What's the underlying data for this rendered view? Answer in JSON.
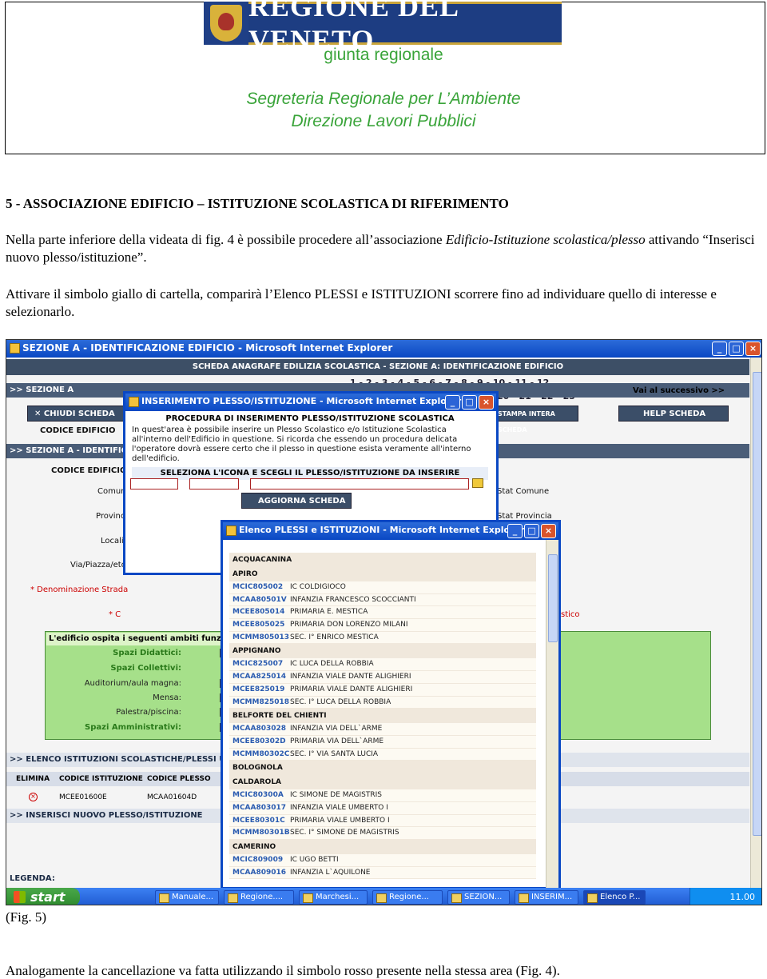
{
  "header": {
    "logo_text": "REGIONE DEL VENETO",
    "giunta": "giunta regionale",
    "segreteria": "Segreteria Regionale per L’Ambiente",
    "direzione": "Direzione Lavori Pubblici"
  },
  "doc": {
    "heading": "5 - ASSOCIAZIONE EDIFICIO – ISTITUZIONE SCOLASTICA DI RIFERIMENTO",
    "p1_a": "Nella parte inferiore della videata di fig. 4 è possibile procedere all’associazione ",
    "p1_em": "Edificio-Istituzione scolastica/plesso",
    "p1_b": " attivando “Inserisci nuovo plesso/istituzione”.",
    "p2": "Attivare il simbolo giallo di cartella, comparirà l’Elenco PLESSI e ISTITUZIONI scorrere fino ad individuare quello di interesse e selezionarlo.",
    "fig_caption": "(Fig. 5)",
    "last": "Analogamente la cancellazione va fatta utilizzando il simbolo rosso presente nella stessa area (Fig. 4)."
  },
  "screenshot": {
    "main_title": "SEZIONE A - IDENTIFICAZIONE EDIFICIO - Microsoft Internet Explorer",
    "scheda_header": "SCHEDA ANAGRAFE EDILIZIA SCOLASTICA - SEZIONE A: IDENTIFICAZIONE EDIFICIO",
    "pages_row1": "1 - 2 - 3 - 4 - 5 - 6 - 7 - 8 - 9 - 10 - 11 - 12",
    "pages_row2": "20 - 21 - 22 - 23",
    "sezione_a": ">> SEZIONE A",
    "vai_successivo": "Vai al successivo >>",
    "chiudi_scheda": "CHIUDI SCHEDA",
    "stampa": "STAMPA INTERA SCHEDA",
    "help": "HELP SCHEDA",
    "codice_edificio": "CODICE EDIFICIO",
    "sezione_a_ident": ">> SEZIONE A - IDENTIFICAZIONE",
    "codice_edificio2": "CODICE EDIFICIO",
    "comune": "Comune",
    "provincia": "Provincia",
    "localita": "Località",
    "via": "Via/Piazza/etc",
    "denominazione": "* Denominazione Strada",
    "cap_star": "* C",
    "stat_comune": "Stat Comune",
    "stat_provincia": "Stat Provincia",
    "istico": "stico",
    "ambiti_header": "L'edificio ospita i seguenti ambiti funzionali",
    "ambiti": [
      "Spazi Didattici:",
      "Spazi Collettivi:",
      "Auditorium/aula magna:",
      "Mensa:",
      "Palestra/piscina:",
      "Spazi Amministrativi:"
    ],
    "check_mark": "✓",
    "elenco_header": ">> ELENCO ISTITUZIONI SCOLASTICHE/PLESSI UBICATI",
    "col_elimina": "ELIMINA",
    "col_cod_ist": "CODICE ISTITUZIONE",
    "col_cod_plesso": "CODICE PLESSO",
    "row_ist": "MCEE01600E",
    "row_plesso": "MCAA01604D",
    "inserisci": ">> INSERISCI NUOVO PLESSO/ISTITUZIONE",
    "legenda": "LEGENDA:",
    "pop1_title": "INSERIMENTO PLESSO/ISTITUZIONE - Microsoft Internet Explorer",
    "pop1_heading": "PROCEDURA DI INSERIMENTO PLESSO/ISTITUZIONE SCOLASTICA",
    "pop1_text": "In quest'area è possibile inserire un Plesso Scolastico e/o Istituzione Scolastica all'interno dell'Edificio in questione. Si ricorda che essendo un procedura delicata l'operatore dovrà essere certo che il plesso in questione esista veramente all'interno dell'edificio.",
    "pop1_select": "SELEZIONA L'ICONA E SCEGLI IL PLESSO/ISTITUZIONE DA INSERIRE",
    "pop1_button": "AGGIORNA SCHEDA",
    "pop2_title": "Elenco PLESSI e ISTITUZIONI - Microsoft Internet Explorer",
    "list": [
      {
        "group": "ACQUACANINA",
        "items": []
      },
      {
        "group": "APIRO",
        "items": [
          {
            "code": "MCIC805002",
            "name": "IC COLDIGIOCO"
          },
          {
            "code": "MCAA80501V",
            "name": "INFANZIA FRANCESCO SCOCCIANTI"
          },
          {
            "code": "MCEE805014",
            "name": "PRIMARIA E. MESTICA"
          },
          {
            "code": "MCEE805025",
            "name": "PRIMARIA DON LORENZO MILANI"
          },
          {
            "code": "MCMM805013",
            "name": "SEC. I° ENRICO MESTICA"
          }
        ]
      },
      {
        "group": "APPIGNANO",
        "items": [
          {
            "code": "MCIC825007",
            "name": "IC LUCA DELLA ROBBIA"
          },
          {
            "code": "MCAA825014",
            "name": "INFANZIA VIALE DANTE ALIGHIERI"
          },
          {
            "code": "MCEE825019",
            "name": "PRIMARIA VIALE DANTE ALIGHIERI"
          },
          {
            "code": "MCMM825018",
            "name": "SEC. I° LUCA DELLA ROBBIA"
          }
        ]
      },
      {
        "group": "BELFORTE DEL CHIENTI",
        "items": [
          {
            "code": "MCAA803028",
            "name": "INFANZIA VIA DELL`ARME"
          },
          {
            "code": "MCEE80302D",
            "name": "PRIMARIA VIA DELL`ARME"
          },
          {
            "code": "MCMM80302C",
            "name": "SEC. I° VIA SANTA LUCIA"
          }
        ]
      },
      {
        "group": "BOLOGNOLA",
        "items": []
      },
      {
        "group": "CALDAROLA",
        "items": [
          {
            "code": "MCIC80300A",
            "name": "IC SIMONE DE MAGISTRIS"
          },
          {
            "code": "MCAA803017",
            "name": "INFANZIA VIALE UMBERTO I"
          },
          {
            "code": "MCEE80301C",
            "name": "PRIMARIA VIALE UMBERTO I"
          },
          {
            "code": "MCMM80301B",
            "name": "SEC. I° SIMONE DE MAGISTRIS"
          }
        ]
      },
      {
        "group": "CAMERINO",
        "items": [
          {
            "code": "MCIC809009",
            "name": "IC UGO BETTI"
          },
          {
            "code": "MCAA809016",
            "name": "INFANZIA L`AQUILONE"
          }
        ]
      }
    ],
    "taskbar": {
      "start": "start",
      "items": [
        "Manuale...",
        "Regione....",
        "Marchesi...",
        "Regione...",
        "SEZION...",
        "INSERIM...",
        "Elenco P..."
      ],
      "clock": "11.00"
    }
  },
  "colors": {
    "green_text": "#3aa43a",
    "xp_blue": "#0a48c4",
    "logo_blue": "#1d3d82"
  }
}
